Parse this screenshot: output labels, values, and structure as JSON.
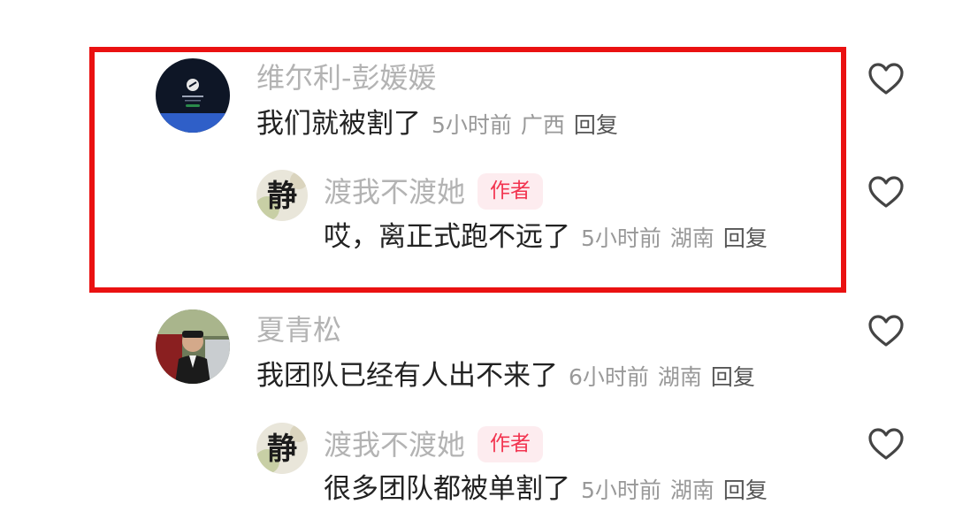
{
  "comments": [
    {
      "username": "维尔利-彭媛媛",
      "text": "我们就被割了",
      "time": "5小时前",
      "location": "广西",
      "reply_label": "回复",
      "replies": [
        {
          "username": "渡我不渡她",
          "badge": "作者",
          "text": "哎，离正式跑不远了",
          "time": "5小时前",
          "location": "湖南",
          "reply_label": "回复"
        }
      ]
    },
    {
      "username": "夏青松",
      "text": "我团队已经有人出不来了",
      "time": "6小时前",
      "location": "湖南",
      "reply_label": "回复",
      "replies": [
        {
          "username": "渡我不渡她",
          "badge": "作者",
          "text": "很多团队都被单割了",
          "time": "5小时前",
          "location": "湖南",
          "reply_label": "回复"
        }
      ]
    }
  ],
  "icons": {
    "like": "heart-outline-icon",
    "avatar_author_glyph": "静"
  },
  "colors": {
    "highlight_border": "#ea1111",
    "badge_text": "#f2334f",
    "badge_bg": "#fdecef",
    "username": "#b3b3b3",
    "meta": "#999999"
  }
}
